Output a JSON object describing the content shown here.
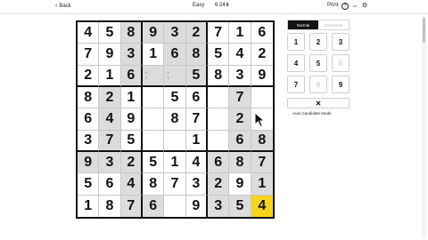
{
  "topbar": {
    "back_label": "Back",
    "level": "Easy",
    "timer": "6:24",
    "pause_glyph": "II",
    "print_label": "Print",
    "help_glyph": "?",
    "more_glyph": "•••",
    "gear_glyph": "⚙"
  },
  "board": {
    "rows": [
      [
        "4",
        "5",
        "8",
        "9",
        "3",
        "2",
        "7",
        "1",
        "6"
      ],
      [
        "7",
        "9",
        "3",
        "1",
        "6",
        "8",
        "5",
        "4",
        "2"
      ],
      [
        "2",
        "1",
        "6",
        "",
        "",
        "5",
        "8",
        "3",
        "9"
      ],
      [
        "8",
        "2",
        "1",
        "",
        "5",
        "6",
        "",
        "7",
        ""
      ],
      [
        "6",
        "4",
        "9",
        "",
        "8",
        "7",
        "",
        "2",
        ""
      ],
      [
        "3",
        "7",
        "5",
        "",
        "",
        "1",
        "",
        "6",
        "8"
      ],
      [
        "9",
        "3",
        "2",
        "5",
        "1",
        "4",
        "6",
        "8",
        "7"
      ],
      [
        "5",
        "6",
        "4",
        "8",
        "7",
        "3",
        "2",
        "9",
        "1"
      ],
      [
        "1",
        "8",
        "7",
        "6",
        "",
        "9",
        "3",
        "5",
        "4"
      ]
    ],
    "shaded": [
      [
        0,
        2
      ],
      [
        0,
        3
      ],
      [
        0,
        4
      ],
      [
        0,
        5
      ],
      [
        1,
        2
      ],
      [
        1,
        4
      ],
      [
        1,
        5
      ],
      [
        2,
        2
      ],
      [
        2,
        3
      ],
      [
        2,
        4
      ],
      [
        2,
        5
      ],
      [
        3,
        1
      ],
      [
        4,
        1
      ],
      [
        5,
        1
      ],
      [
        3,
        7
      ],
      [
        4,
        7
      ],
      [
        5,
        7
      ],
      [
        5,
        8
      ],
      [
        6,
        0
      ],
      [
        6,
        1
      ],
      [
        6,
        2
      ],
      [
        6,
        6
      ],
      [
        6,
        7
      ],
      [
        6,
        8
      ],
      [
        7,
        2
      ],
      [
        7,
        6
      ],
      [
        7,
        8
      ],
      [
        8,
        2
      ],
      [
        8,
        3
      ],
      [
        8,
        6
      ],
      [
        8,
        7
      ]
    ],
    "selected": [
      8,
      8
    ],
    "candidates": [
      {
        "r": 2,
        "c": 3,
        "lines": [
          "4",
          "7"
        ]
      },
      {
        "r": 2,
        "c": 4,
        "lines": [
          "4",
          "7"
        ]
      }
    ]
  },
  "panel": {
    "tab_normal": "Normal",
    "tab_candidate": "Candidate",
    "keys": [
      {
        "label": "1",
        "disabled": false
      },
      {
        "label": "2",
        "disabled": false
      },
      {
        "label": "3",
        "disabled": false
      },
      {
        "label": "4",
        "disabled": false
      },
      {
        "label": "5",
        "disabled": false
      },
      {
        "label": "6",
        "disabled": true
      },
      {
        "label": "7",
        "disabled": false
      },
      {
        "label": "8",
        "disabled": true
      },
      {
        "label": "9",
        "disabled": false
      }
    ],
    "erase_glyph": "✕",
    "auto_candidate_label": "Auto Candidate Mode"
  },
  "colors": {
    "shade": "#dcdcdc",
    "selected": "#f7d51d",
    "tab_active_bg": "#121212"
  }
}
